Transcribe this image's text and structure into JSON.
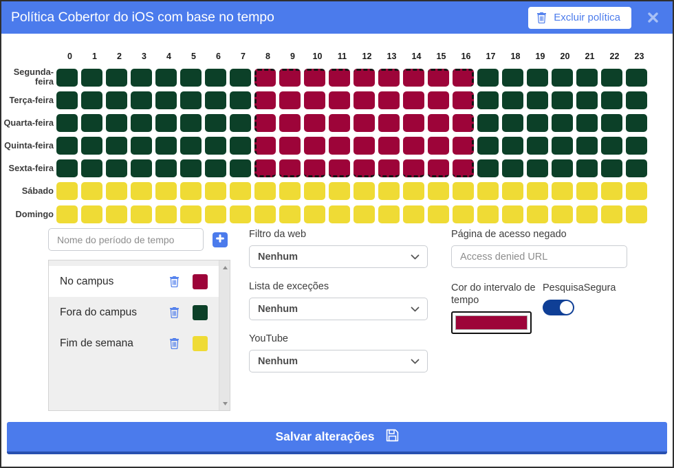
{
  "header": {
    "title": "Política Cobertor do iOS com base no tempo",
    "delete_button_label": "Excluir política",
    "trash_icon": "trash-icon",
    "close_icon": "close-icon",
    "accent_color": "#4b7bec"
  },
  "schedule": {
    "hours": [
      "0",
      "1",
      "2",
      "3",
      "4",
      "5",
      "6",
      "7",
      "8",
      "9",
      "10",
      "11",
      "12",
      "13",
      "14",
      "15",
      "16",
      "17",
      "18",
      "19",
      "20",
      "21",
      "22",
      "23"
    ],
    "days": [
      "Segunda-feira",
      "Terça-feira",
      "Quarta-feira",
      "Quinta-feira",
      "Sexta-feira",
      "Sábado",
      "Domingo"
    ],
    "colors": {
      "green": "#0c4028",
      "maroon": "#9d0439",
      "yellow": "#efdb35"
    },
    "selection": {
      "first_hour": 8,
      "last_hour": 16,
      "first_day": 0,
      "last_day": 4
    },
    "rows": [
      [
        "green",
        "green",
        "green",
        "green",
        "green",
        "green",
        "green",
        "green",
        "maroon",
        "maroon",
        "maroon",
        "maroon",
        "maroon",
        "maroon",
        "maroon",
        "maroon",
        "maroon",
        "green",
        "green",
        "green",
        "green",
        "green",
        "green",
        "green"
      ],
      [
        "green",
        "green",
        "green",
        "green",
        "green",
        "green",
        "green",
        "green",
        "maroon",
        "maroon",
        "maroon",
        "maroon",
        "maroon",
        "maroon",
        "maroon",
        "maroon",
        "maroon",
        "green",
        "green",
        "green",
        "green",
        "green",
        "green",
        "green"
      ],
      [
        "green",
        "green",
        "green",
        "green",
        "green",
        "green",
        "green",
        "green",
        "maroon",
        "maroon",
        "maroon",
        "maroon",
        "maroon",
        "maroon",
        "maroon",
        "maroon",
        "maroon",
        "green",
        "green",
        "green",
        "green",
        "green",
        "green",
        "green"
      ],
      [
        "green",
        "green",
        "green",
        "green",
        "green",
        "green",
        "green",
        "green",
        "maroon",
        "maroon",
        "maroon",
        "maroon",
        "maroon",
        "maroon",
        "maroon",
        "maroon",
        "maroon",
        "green",
        "green",
        "green",
        "green",
        "green",
        "green",
        "green"
      ],
      [
        "green",
        "green",
        "green",
        "green",
        "green",
        "green",
        "green",
        "green",
        "maroon",
        "maroon",
        "maroon",
        "maroon",
        "maroon",
        "maroon",
        "maroon",
        "maroon",
        "maroon",
        "green",
        "green",
        "green",
        "green",
        "green",
        "green",
        "green"
      ],
      [
        "yellow",
        "yellow",
        "yellow",
        "yellow",
        "yellow",
        "yellow",
        "yellow",
        "yellow",
        "yellow",
        "yellow",
        "yellow",
        "yellow",
        "yellow",
        "yellow",
        "yellow",
        "yellow",
        "yellow",
        "yellow",
        "yellow",
        "yellow",
        "yellow",
        "yellow",
        "yellow",
        "yellow"
      ],
      [
        "yellow",
        "yellow",
        "yellow",
        "yellow",
        "yellow",
        "yellow",
        "yellow",
        "yellow",
        "yellow",
        "yellow",
        "yellow",
        "yellow",
        "yellow",
        "yellow",
        "yellow",
        "yellow",
        "yellow",
        "yellow",
        "yellow",
        "yellow",
        "yellow",
        "yellow",
        "yellow",
        "yellow"
      ]
    ]
  },
  "left_column": {
    "name_input_placeholder": "Nome do período de tempo",
    "name_input_value": "",
    "add_icon": "plus-icon",
    "time_periods": [
      {
        "name": "No campus",
        "color": "#9d0439",
        "selected": true,
        "trash_icon": "trash-icon"
      },
      {
        "name": "Fora do campus",
        "color": "#0c4028",
        "selected": false,
        "trash_icon": "trash-icon"
      },
      {
        "name": "Fim de semana",
        "color": "#efdb35",
        "selected": false,
        "trash_icon": "trash-icon"
      }
    ],
    "scrollbar_up_icon": "triangle-up-icon",
    "scrollbar_down_icon": "triangle-down-icon"
  },
  "mid_column": {
    "web_filter": {
      "label": "Filtro da web",
      "value": "Nenhum",
      "caret_icon": "chevron-down-icon"
    },
    "exception_list": {
      "label": "Lista de exceções",
      "value": "Nenhum",
      "caret_icon": "chevron-down-icon"
    },
    "youtube": {
      "label": "YouTube",
      "value": "Nenhum",
      "caret_icon": "chevron-down-icon"
    }
  },
  "right_column": {
    "access_denied": {
      "label": "Página de acesso negado",
      "placeholder": "Access denied URL",
      "value": ""
    },
    "time_range_color": {
      "label": "Cor do intervalo de tempo",
      "color": "#9d0439"
    },
    "safesearch": {
      "label": "PesquisaSegura",
      "enabled": true
    }
  },
  "footer": {
    "save_label": "Salvar alterações",
    "save_icon": "floppy-disk-icon"
  }
}
